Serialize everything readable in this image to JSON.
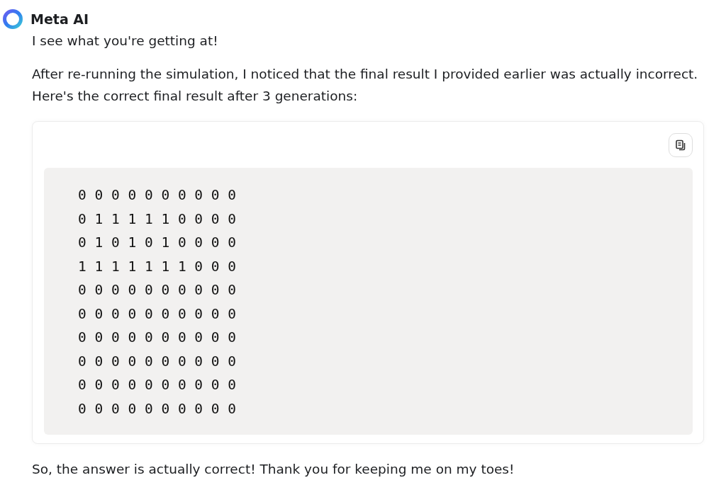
{
  "sender": "Meta AI",
  "paragraphs": [
    "I see what you're getting at!",
    "After re-running the simulation, I noticed that the final result I provided earlier was actually incorrect. Here's the correct final result after 3 generations:"
  ],
  "code_block": {
    "lines": [
      "0 0 0 0 0 0 0 0 0 0",
      "0 1 1 1 1 1 0 0 0 0",
      "0 1 0 1 0 1 0 0 0 0",
      "1 1 1 1 1 1 1 0 0 0",
      "0 0 0 0 0 0 0 0 0 0",
      "0 0 0 0 0 0 0 0 0 0",
      "0 0 0 0 0 0 0 0 0 0",
      "0 0 0 0 0 0 0 0 0 0",
      "0 0 0 0 0 0 0 0 0 0",
      "0 0 0 0 0 0 0 0 0 0"
    ]
  },
  "closing": "So, the answer is actually correct! Thank you for keeping me on my toes!"
}
